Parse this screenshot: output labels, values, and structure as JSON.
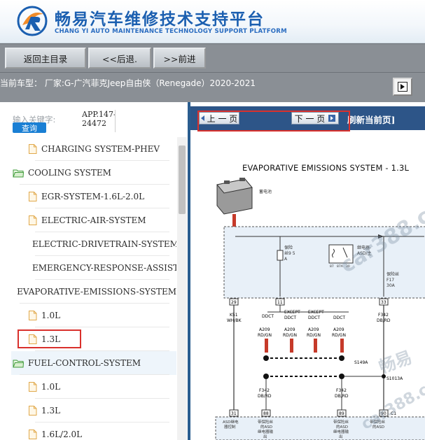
{
  "header": {
    "title": "畅易汽车维修技术支持平台",
    "subtitle": "CHANG YI AUTO MAINTENANCE TECHNOLOGY SUPPORT PLATFORM"
  },
  "toolbar": {
    "home_label": "返回主目录",
    "back_label": "<<后退.",
    "forward_label": ">>前进"
  },
  "info": {
    "current_model": "当前车型：  厂家:G-广汽菲克Jeep自由侠（Renegade）2020-2021"
  },
  "search": {
    "label": "输入关键字:",
    "value": "APP.147-24472",
    "button": "查询"
  },
  "tree": [
    {
      "label": "CHARGING SYSTEM-PHEV",
      "type": "file"
    },
    {
      "label": "COOLING SYSTEM",
      "type": "folder"
    },
    {
      "label": "EGR-SYSTEM-1.6L-2.0L",
      "type": "file"
    },
    {
      "label": "ELECTRIC-AIR-SYSTEM",
      "type": "file"
    },
    {
      "label": "ELECTRIC-DRIVETRAIN-SYSTEM",
      "type": "file"
    },
    {
      "label": "EMERGENCY-RESPONSE-ASSIST",
      "type": "file"
    },
    {
      "label": "EVAPORATIVE-EMISSIONS-SYSTEM",
      "type": "folder"
    },
    {
      "label": "1.0L",
      "type": "file"
    },
    {
      "label": "1.3L",
      "type": "file"
    },
    {
      "label": "FUEL-CONTROL-SYSTEM",
      "type": "folder"
    },
    {
      "label": "1.0L",
      "type": "file"
    },
    {
      "label": "1.3L",
      "type": "file"
    },
    {
      "label": "1.6L/2.0L",
      "type": "file"
    }
  ],
  "viewer": {
    "prev_label": "上 一 页",
    "next_label": "下 一 页",
    "refresh_label": "刷新当前页]",
    "doc_title": "EVAPORATIVE EMISSIONS SYSTEM - 1.3L"
  },
  "diagram": {
    "battery_label": "蓄电池",
    "fuse_label1": "保险",
    "fuse_label2": "丝9 5",
    "fuse_label3": "A",
    "relay_label1": "继电器-",
    "relay_label2": "ASD/主",
    "relay_r1": "87",
    "relay_r2": "87A",
    "relay_r3": "30",
    "fuse2_label1": "保险丝",
    "fuse2_label2": "F17",
    "fuse2_label3": "30A",
    "connector_29": "29",
    "connector_11": "11",
    "connector_33": "33",
    "connector_31": "31",
    "connector_88": "88",
    "connector_89": "89",
    "connector_90": "90",
    "connector_c1": "C1",
    "wire_k51": "K51",
    "wire_whbk": "WH/BK",
    "wire_f342": "F342",
    "wire_dbrd": "DB/RD",
    "wire_a209": "A209",
    "wire_rdgn": "RD/GN",
    "ddct": "DDCT",
    "except": "EXCEPT",
    "splice_1": "S149A",
    "splice_2": "S1013A",
    "bottom_1": "ASD继电",
    "bottom_1b": "器控制",
    "bottom_2": "带保险丝",
    "bottom_2b": "的ASD",
    "bottom_2c": "继电器输",
    "bottom_2d": "出"
  },
  "watermarks": [
    "car388.c",
    "畅易",
    "car388.c"
  ],
  "colors": {
    "accent": "#1b5fb0",
    "toolbar_bg": "#8a8f95",
    "nav_strip": "#2d5588",
    "highlight": "#d9302c",
    "wire_red": "#c63a2a"
  }
}
